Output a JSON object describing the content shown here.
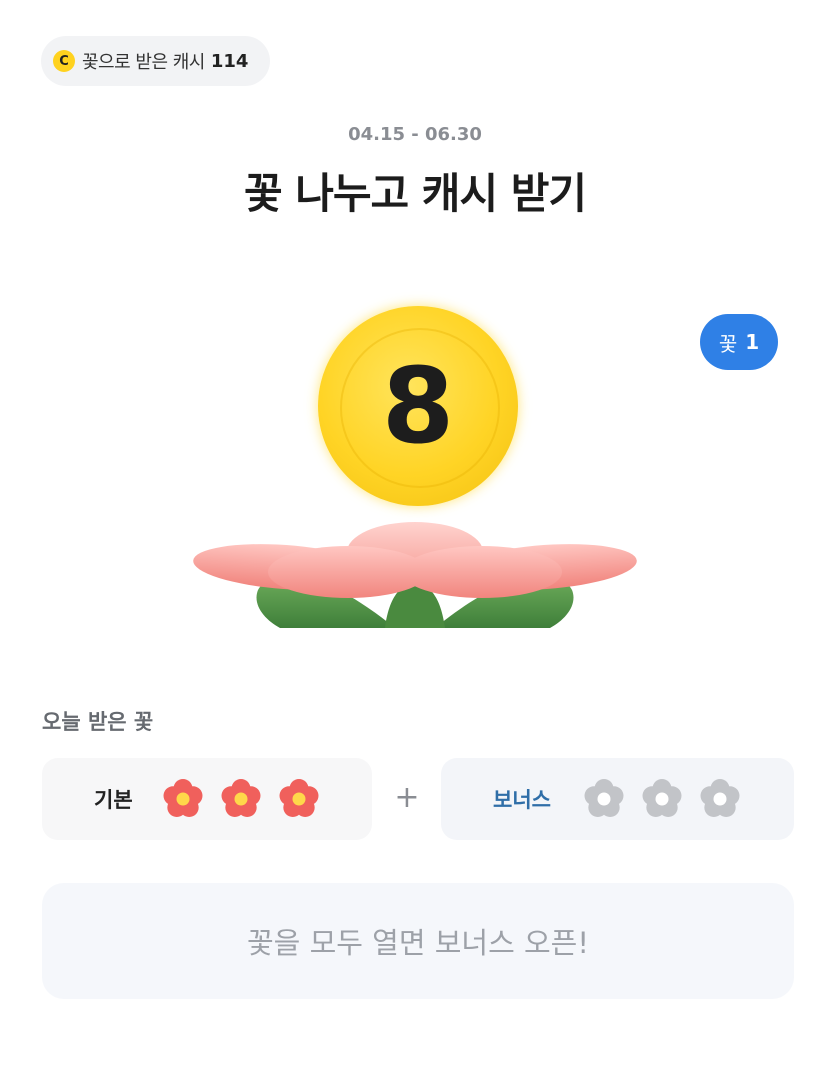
{
  "header": {
    "cash_label": "꽃으로 받은 캐시",
    "cash_value": "114",
    "coin_symbol": "C"
  },
  "event": {
    "date_range": "04.15 - 06.30",
    "title": "꽃 나누고 캐시 받기"
  },
  "hero": {
    "coin_number": "8",
    "flower_badge_label": "꽃",
    "flower_badge_count": "1"
  },
  "today": {
    "section_title": "오늘 받은 꽃",
    "basic_label": "기본",
    "basic_flowers_received": 3,
    "bonus_label": "보너스",
    "bonus_flowers_received": 0,
    "plus": "+"
  },
  "cta": {
    "label": "꽃을 모두 열면 보너스 오픈!"
  },
  "colors": {
    "flower_active": "#f0605c",
    "flower_center": "#ffd84a",
    "flower_inactive": "#c2c4c8",
    "badge_blue": "#2f80e6",
    "coin_yellow": "#ffd425",
    "bonus_label": "#2f6ea8"
  }
}
